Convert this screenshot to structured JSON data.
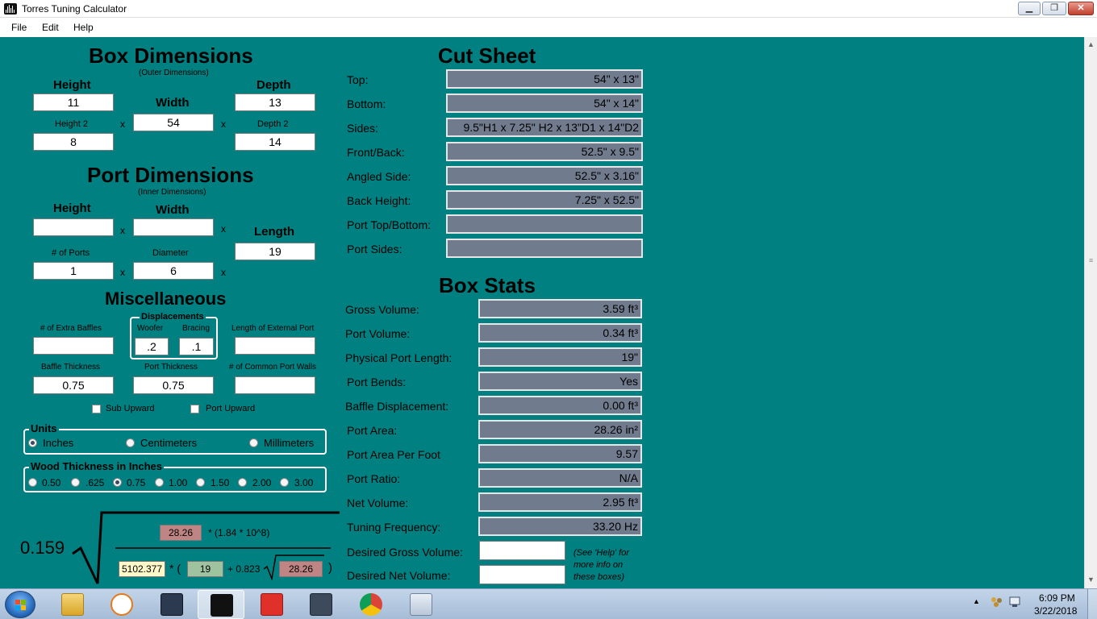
{
  "window": {
    "title": "Torres Tuning Calculator",
    "minimize_glyph": "▁",
    "maximize_glyph": "❐",
    "close_glyph": "✕"
  },
  "menu": [
    "File",
    "Edit",
    "Help"
  ],
  "box_dimensions": {
    "title": "Box Dimensions",
    "subtitle": "(Outer Dimensions)",
    "height_label": "Height",
    "height_value": "11",
    "width_label": "Width",
    "width_value": "54",
    "depth_label": "Depth",
    "depth_value": "13",
    "height2_label": "Height 2",
    "height2_value": "8",
    "depth2_label": "Depth 2",
    "depth2_value": "14",
    "times": "x"
  },
  "port_dimensions": {
    "title": "Port Dimensions",
    "subtitle": "(Inner Dimensions)",
    "height_label": "Height",
    "height_value": "",
    "width_label": "Width",
    "width_value": "",
    "length_label": "Length",
    "length_value": "19",
    "ports_label": "# of Ports",
    "ports_value": "1",
    "diameter_label": "Diameter",
    "diameter_value": "6",
    "times": "x"
  },
  "misc": {
    "title": "Miscellaneous",
    "extra_baffles_label": "# of Extra Baffles",
    "extra_baffles_value": "",
    "displacements_title": "Displacements",
    "woofer_label": "Woofer",
    "woofer_value": ".2",
    "bracing_label": "Bracing",
    "bracing_value": ".1",
    "ext_port_label": "Length of External Port",
    "ext_port_value": "",
    "baffle_thickness_label": "Baffle Thickness",
    "baffle_thickness_value": "0.75",
    "port_thickness_label": "Port Thickness",
    "port_thickness_value": "0.75",
    "common_walls_label": "# of Common Port Walls",
    "common_walls_value": "",
    "sub_upward_label": "Sub Upward",
    "port_upward_label": "Port Upward"
  },
  "units": {
    "title": "Units",
    "options": [
      "Inches",
      "Centimeters",
      "Millimeters"
    ],
    "selected": "Inches"
  },
  "wood": {
    "title": "Wood Thickness in Inches",
    "options": [
      "0.50",
      ".625",
      "0.75",
      "1.00",
      "1.50",
      "2.00",
      "3.00"
    ],
    "selected": "0.75"
  },
  "formula": {
    "constant": "0.159",
    "area": "28.26",
    "multiplier": "* (1.84 * 10^8)",
    "volume": "5102.377",
    "mult_open": "* (",
    "length": "19",
    "end_correction": "+ 0.823",
    "area2": "28.26",
    "close": ")"
  },
  "cut_sheet": {
    "title": "Cut Sheet",
    "rows": [
      {
        "label": "Top:",
        "value": "54\" x 13\""
      },
      {
        "label": "Bottom:",
        "value": "54\" x 14\""
      },
      {
        "label": "Sides:",
        "value": "9.5\"H1 x 7.25\" H2 x 13\"D1 x 14\"D2"
      },
      {
        "label": "Front/Back:",
        "value": "52.5\" x 9.5\""
      },
      {
        "label": "Angled Side:",
        "value": "52.5\" x 3.16\""
      },
      {
        "label": "Back Height:",
        "value": "7.25\" x 52.5\""
      },
      {
        "label": "Port Top/Bottom:",
        "value": ""
      },
      {
        "label": "Port Sides:",
        "value": ""
      }
    ]
  },
  "box_stats": {
    "title": "Box Stats",
    "rows": [
      {
        "label": "Gross Volume:",
        "value": "3.59 ft³"
      },
      {
        "label": "Port Volume:",
        "value": "0.34 ft³"
      },
      {
        "label": "Physical Port Length:",
        "value": "19\""
      },
      {
        "label": "Port Bends:",
        "value": "Yes"
      },
      {
        "label": "Baffle Displacement:",
        "value": "0.00 ft³"
      },
      {
        "label": "Port Area:",
        "value": "28.26 in²"
      },
      {
        "label": "Port Area Per Foot",
        "value": "9.57"
      },
      {
        "label": "Port Ratio:",
        "value": "N/A"
      },
      {
        "label": "Net Volume:",
        "value": "2.95 ft³"
      },
      {
        "label": "Tuning Frequency:",
        "value": "33.20 Hz"
      }
    ],
    "desired_gross_label": "Desired Gross Volume:",
    "desired_gross_value": "",
    "desired_net_label": "Desired Net Volume:",
    "desired_net_value": "",
    "help_note": "(See 'Help' for more info on these boxes)"
  },
  "taskbar": {
    "apps": [
      "explorer",
      "media-player",
      "dialog-app",
      "tuning-calculator",
      "sketchup",
      "winisd",
      "chrome",
      "calculator"
    ],
    "active": "tuning-calculator",
    "time": "6:09 PM",
    "date": "3/22/2018",
    "tray_arrow": "▲"
  },
  "colors": {
    "background": "#008080",
    "output_field": "#717b8e",
    "formula_red": "#bf8585",
    "formula_green": "#9fc39f",
    "formula_yellow": "#fff8c8"
  }
}
